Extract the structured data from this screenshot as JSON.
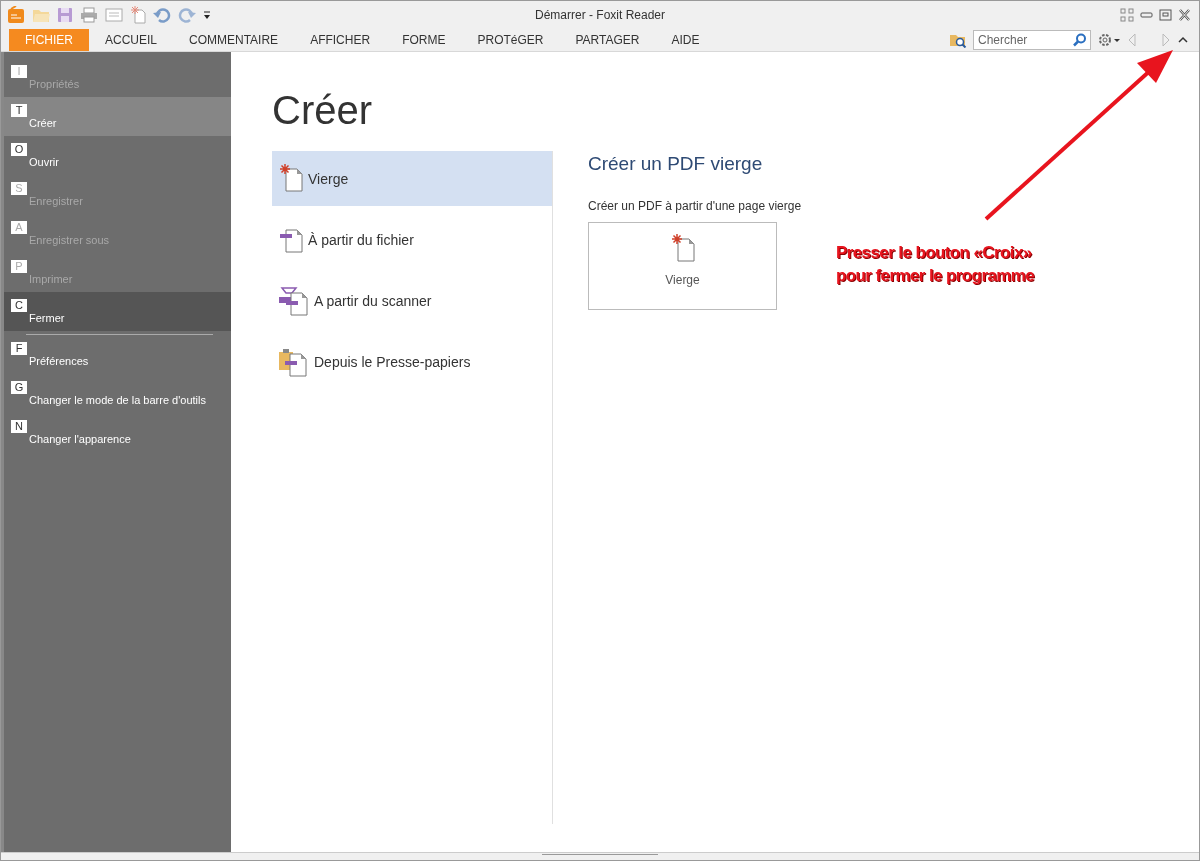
{
  "window": {
    "title": "Démarrer - Foxit Reader"
  },
  "ribbon": {
    "tabs": [
      {
        "label": "FICHIER",
        "selected": true
      },
      {
        "label": "ACCUEIL",
        "selected": false
      },
      {
        "label": "COMMENTAIRE",
        "selected": false
      },
      {
        "label": "AFFICHER",
        "selected": false
      },
      {
        "label": "FORME",
        "selected": false
      },
      {
        "label": "PROTéGER",
        "selected": false
      },
      {
        "label": "PARTAGER",
        "selected": false
      },
      {
        "label": "AIDE",
        "selected": false
      }
    ],
    "search": {
      "placeholder": "Chercher"
    }
  },
  "sidebar": {
    "items": [
      {
        "kind": "command",
        "key": "I",
        "label": "Propriétés",
        "disabled": true,
        "selected": false,
        "highlighted": false
      },
      {
        "kind": "command",
        "key": "T",
        "label": "Créer",
        "disabled": false,
        "selected": true,
        "highlighted": false
      },
      {
        "kind": "command",
        "key": "O",
        "label": "Ouvrir",
        "disabled": false,
        "selected": false,
        "highlighted": false
      },
      {
        "kind": "command",
        "key": "S",
        "label": "Enregistrer",
        "disabled": true,
        "selected": false,
        "highlighted": false
      },
      {
        "kind": "command",
        "key": "A",
        "label": "Enregistrer sous",
        "disabled": true,
        "selected": false,
        "highlighted": false
      },
      {
        "kind": "command",
        "key": "P",
        "label": "Imprimer",
        "disabled": true,
        "selected": false,
        "highlighted": false
      },
      {
        "kind": "command",
        "key": "C",
        "label": "Fermer",
        "disabled": false,
        "selected": false,
        "highlighted": true
      },
      {
        "kind": "separator"
      },
      {
        "kind": "command",
        "key": "F",
        "label": "Préférences",
        "disabled": false,
        "selected": false,
        "highlighted": false
      },
      {
        "kind": "command",
        "key": "G",
        "label": "Changer le mode de la barre d'outils",
        "disabled": false,
        "selected": false,
        "highlighted": false
      },
      {
        "kind": "command",
        "key": "N",
        "label": "Changer l'apparence",
        "disabled": false,
        "selected": false,
        "highlighted": false
      }
    ]
  },
  "page": {
    "title": "Créer",
    "options": [
      {
        "kind": "blank",
        "label": "Vierge",
        "selected": true
      },
      {
        "kind": "file",
        "label": "À partir du fichier",
        "selected": false
      },
      {
        "kind": "scanner",
        "label": "A partir du scanner",
        "selected": false
      },
      {
        "kind": "clipboard",
        "label": "Depuis le Presse-papiers",
        "selected": false
      }
    ]
  },
  "detail": {
    "title": "Créer un PDF vierge",
    "description": "Créer un PDF à partir d'une page vierge",
    "tile": {
      "kind": "blank",
      "label": "Vierge"
    }
  },
  "annotation": {
    "lines": [
      "Presser le bouton «Croix»",
      "pour fermer le programme"
    ]
  }
}
